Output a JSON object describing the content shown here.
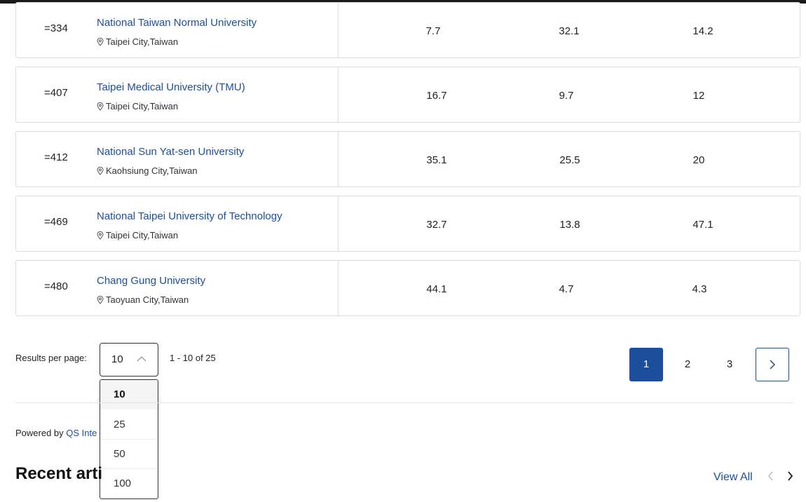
{
  "rows": [
    {
      "rank": "=334",
      "name": "National Taiwan Normal University",
      "location": "Taipei City,Taiwan",
      "scores": [
        "7.7",
        "32.1",
        "14.2"
      ]
    },
    {
      "rank": "=407",
      "name": "Taipei Medical University (TMU)",
      "location": "Taipei City,Taiwan",
      "scores": [
        "16.7",
        "9.7",
        "12"
      ]
    },
    {
      "rank": "=412",
      "name": "National Sun Yat-sen University",
      "location": "Kaohsiung City,Taiwan",
      "scores": [
        "35.1",
        "25.5",
        "20"
      ]
    },
    {
      "rank": "=469",
      "name": "National Taipei University of Technology",
      "location": "Taipei City,Taiwan",
      "scores": [
        "32.7",
        "13.8",
        "47.1"
      ]
    },
    {
      "rank": "=480",
      "name": "Chang Gung University",
      "location": "Taoyuan City,Taiwan",
      "scores": [
        "44.1",
        "4.7",
        "4.3"
      ]
    }
  ],
  "pagination": {
    "results_label": "Results per page:",
    "selected": "10",
    "options": [
      "10",
      "25",
      "50",
      "100"
    ],
    "range": "1 - 10 of 25",
    "pages": [
      "1",
      "2",
      "3"
    ],
    "current_page": "1"
  },
  "footer": {
    "powered_prefix": "Powered by ",
    "powered_link": "QS Inte"
  },
  "recent": {
    "title": "Recent arti",
    "view_all": "View All"
  },
  "colors": {
    "accent": "#1b4f9b",
    "border": "#dcdcdc"
  }
}
